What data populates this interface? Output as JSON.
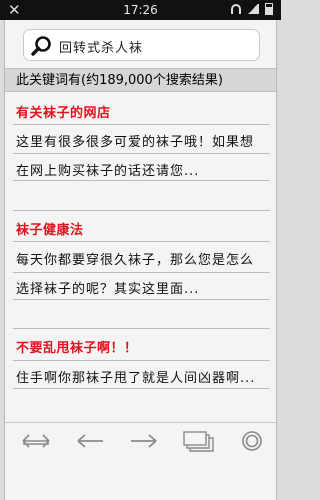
{
  "status_bar": {
    "time": "17:26",
    "icons": [
      "close-icon",
      "wifi-icon",
      "signal-icon",
      "battery-icon"
    ]
  },
  "search": {
    "query": "回转式杀人袜",
    "icon": "search-icon"
  },
  "result_count": "此关键词有(约189,000个搜索结果)",
  "results": [
    {
      "title": "有关袜子的网店",
      "lines": [
        "这里有很多很多可爱的袜子哦！如果想",
        "在网上购买袜子的话还请您..."
      ]
    },
    {
      "title": "袜子健康法",
      "lines": [
        "每天你都要穿很久袜子，那么您是怎么",
        "选择袜子的呢？其实这里面..."
      ]
    },
    {
      "title": "不要乱甩袜子啊！！",
      "lines": [
        "住手啊你那袜子甩了就是人间凶器啊..."
      ]
    }
  ],
  "toolbar": {
    "buttons": [
      "swap-arrows-icon",
      "back-arrow-icon",
      "forward-arrow-icon",
      "tabs-icon",
      "home-circle-icon"
    ]
  },
  "colors": {
    "title_red": "#e0141e",
    "background": "#f4f4f4",
    "count_bar": "#d6d6d6"
  }
}
